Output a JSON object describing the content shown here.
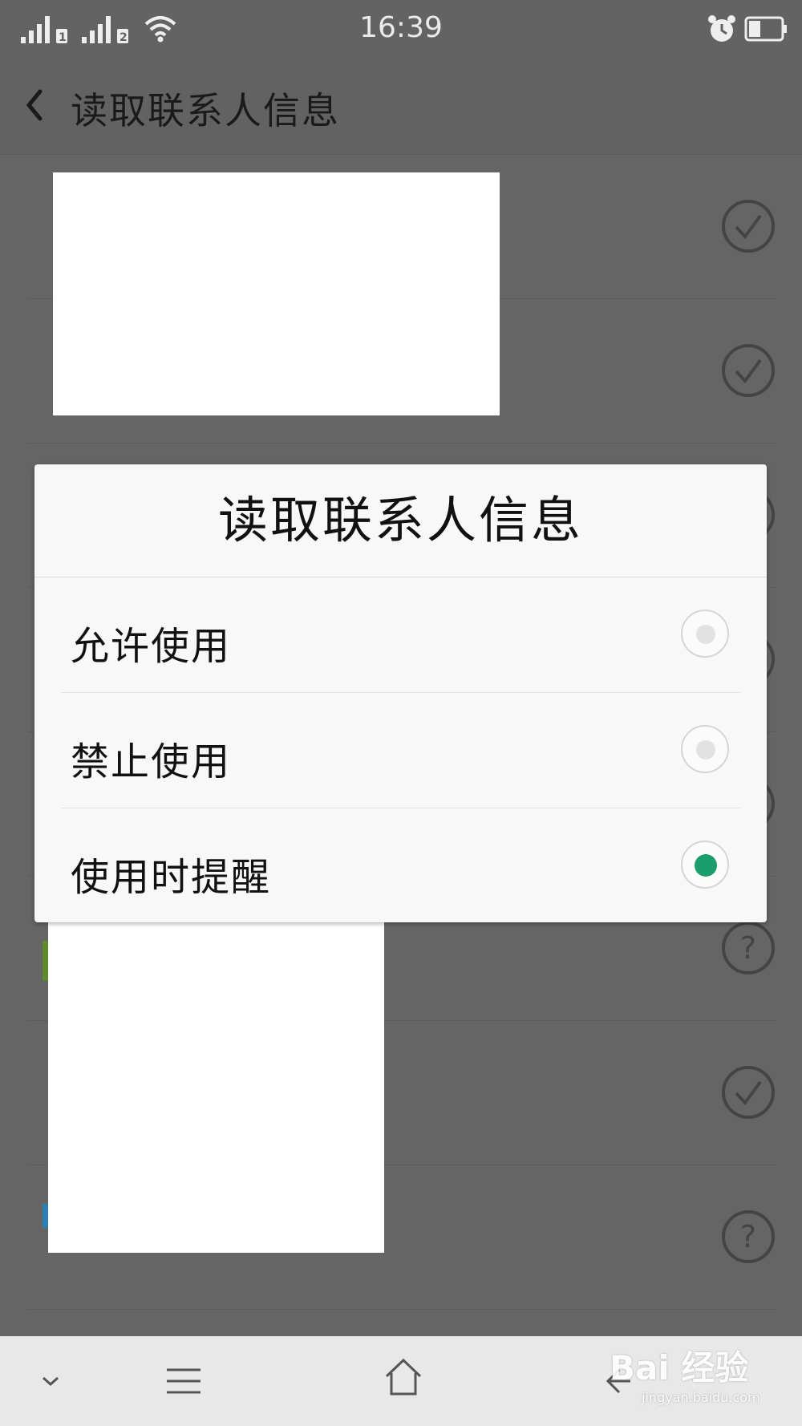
{
  "status_bar": {
    "time": "16:39",
    "sim1_label": "1",
    "sim2_label": "2",
    "icons": [
      "signal-icon",
      "wifi-icon",
      "alarm-icon",
      "battery-icon"
    ]
  },
  "header": {
    "title": "读取联系人信息",
    "back_icon": "back-arrow-icon"
  },
  "app_list": {
    "rows": [
      {
        "status_icon": "check-circle-icon"
      },
      {
        "status_icon": "check-circle-icon"
      },
      {
        "status_icon": "check-circle-icon"
      },
      {
        "status_icon": "check-circle-icon"
      },
      {
        "status_icon": "check-circle-icon"
      },
      {
        "status_icon": "question-circle-icon"
      },
      {
        "status_icon": "check-circle-icon"
      },
      {
        "status_icon": "question-circle-icon"
      }
    ]
  },
  "dialog": {
    "title": "读取联系人信息",
    "options": [
      {
        "label": "允许使用",
        "selected": false
      },
      {
        "label": "禁止使用",
        "selected": false
      },
      {
        "label": "使用时提醒",
        "selected": true
      }
    ],
    "accent_color": "#1a9e6e"
  },
  "nav_bar": {
    "icons": [
      "chevron-down-icon",
      "menu-icon",
      "home-icon",
      "back-icon"
    ]
  },
  "watermark": {
    "main": "Bai 经验",
    "sub": "jingyan.baidu.com"
  }
}
